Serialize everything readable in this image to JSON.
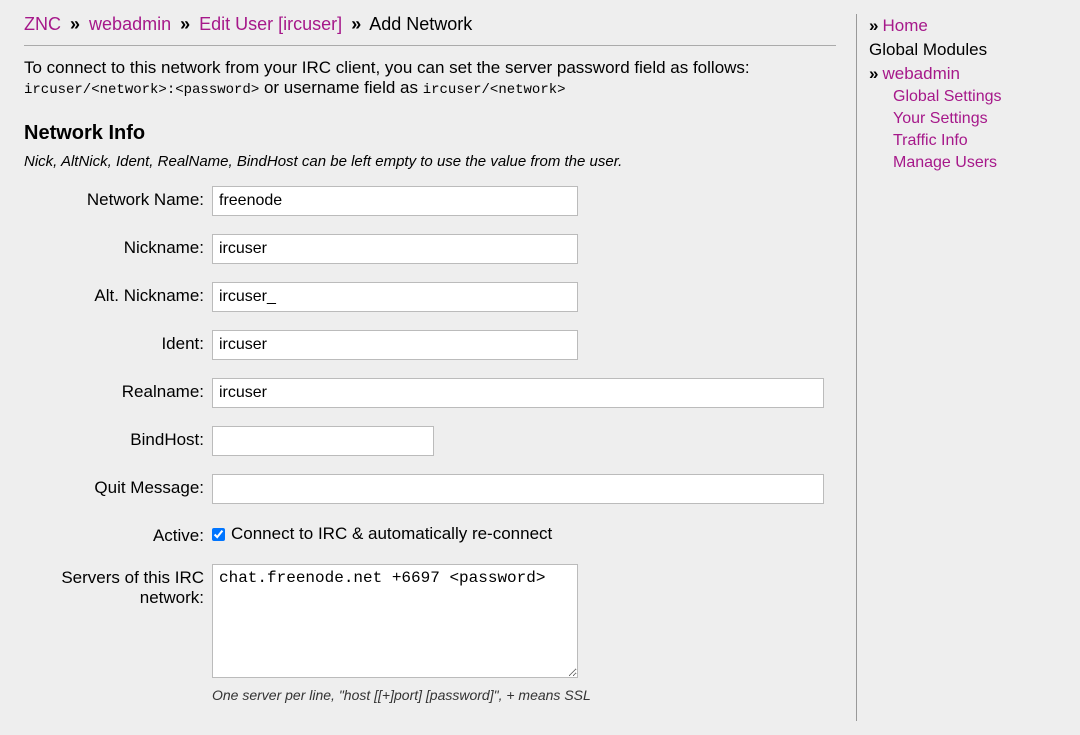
{
  "breadcrumb": {
    "znc": "ZNC",
    "webadmin": "webadmin",
    "edit_user": "Edit User [ircuser]",
    "add_network": "Add Network",
    "sep": "»"
  },
  "help": {
    "line1": "To connect to this network from your IRC client, you can set the server password field as follows:",
    "code1": "ircuser/<network>:<password>",
    "mid": " or username field as ",
    "code2": "ircuser/<network>"
  },
  "section": {
    "title": "Network Info",
    "sub": "Nick, AltNick, Ident, RealName, BindHost can be left empty to use the value from the user."
  },
  "fields": {
    "network_name": {
      "label": "Network Name:",
      "value": "freenode"
    },
    "nickname": {
      "label": "Nickname:",
      "value": "ircuser"
    },
    "alt_nickname": {
      "label": "Alt. Nickname:",
      "value": "ircuser_"
    },
    "ident": {
      "label": "Ident:",
      "value": "ircuser"
    },
    "realname": {
      "label": "Realname:",
      "value": "ircuser"
    },
    "bindhost": {
      "label": "BindHost:",
      "value": ""
    },
    "quit_message": {
      "label": "Quit Message:",
      "value": ""
    },
    "active": {
      "label": "Active:",
      "checkbox_label": "Connect to IRC & automatically re-connect",
      "checked": true
    },
    "servers": {
      "label": "Servers of this IRC network:",
      "value": "chat.freenode.net +6697 <password>",
      "note": "One server per line, \"host [[+]port] [password]\", + means SSL"
    }
  },
  "sidebar": {
    "home": "Home",
    "global_modules": "Global Modules",
    "webadmin": "webadmin",
    "sub": {
      "global_settings": "Global Settings",
      "your_settings": "Your Settings",
      "traffic_info": "Traffic Info",
      "manage_users": "Manage Users"
    }
  }
}
